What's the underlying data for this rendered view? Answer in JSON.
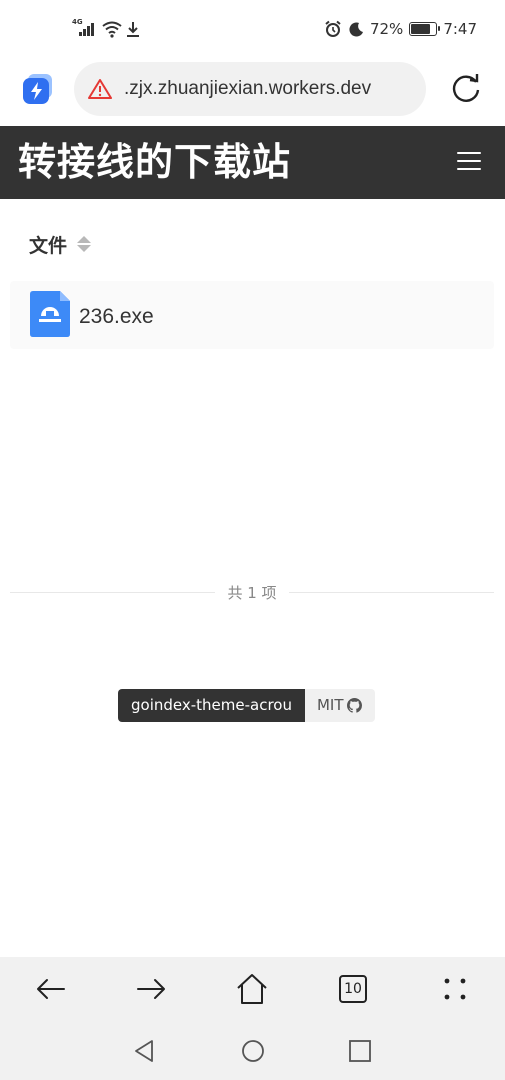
{
  "status_bar": {
    "network": "4G",
    "battery": "72%",
    "time": "7:47",
    "icons": [
      "signal-icon",
      "wifi-icon",
      "download-icon",
      "alarm-icon",
      "moon-icon",
      "battery-icon"
    ]
  },
  "browser": {
    "url": ".zjx.zhuanjiexian.workers.dev",
    "icons": [
      "app-logo-icon",
      "warning-icon",
      "reload-icon"
    ]
  },
  "site": {
    "title": "转接线的下载站"
  },
  "list": {
    "column_label": "文件",
    "files": [
      {
        "name": "236.exe",
        "icon": "file-exe-icon"
      }
    ],
    "count_text": "共 1 项"
  },
  "footer": {
    "theme_label": "goindex-theme-acrou",
    "license_label": "MIT"
  },
  "bottom_nav": {
    "tab_count": "10",
    "icons": [
      "back-icon",
      "forward-icon",
      "home-icon",
      "tabs-icon",
      "more-icon"
    ]
  },
  "colors": {
    "header_bg": "#333333",
    "file_icon": "#3d8af7",
    "warning": "#e53935"
  }
}
